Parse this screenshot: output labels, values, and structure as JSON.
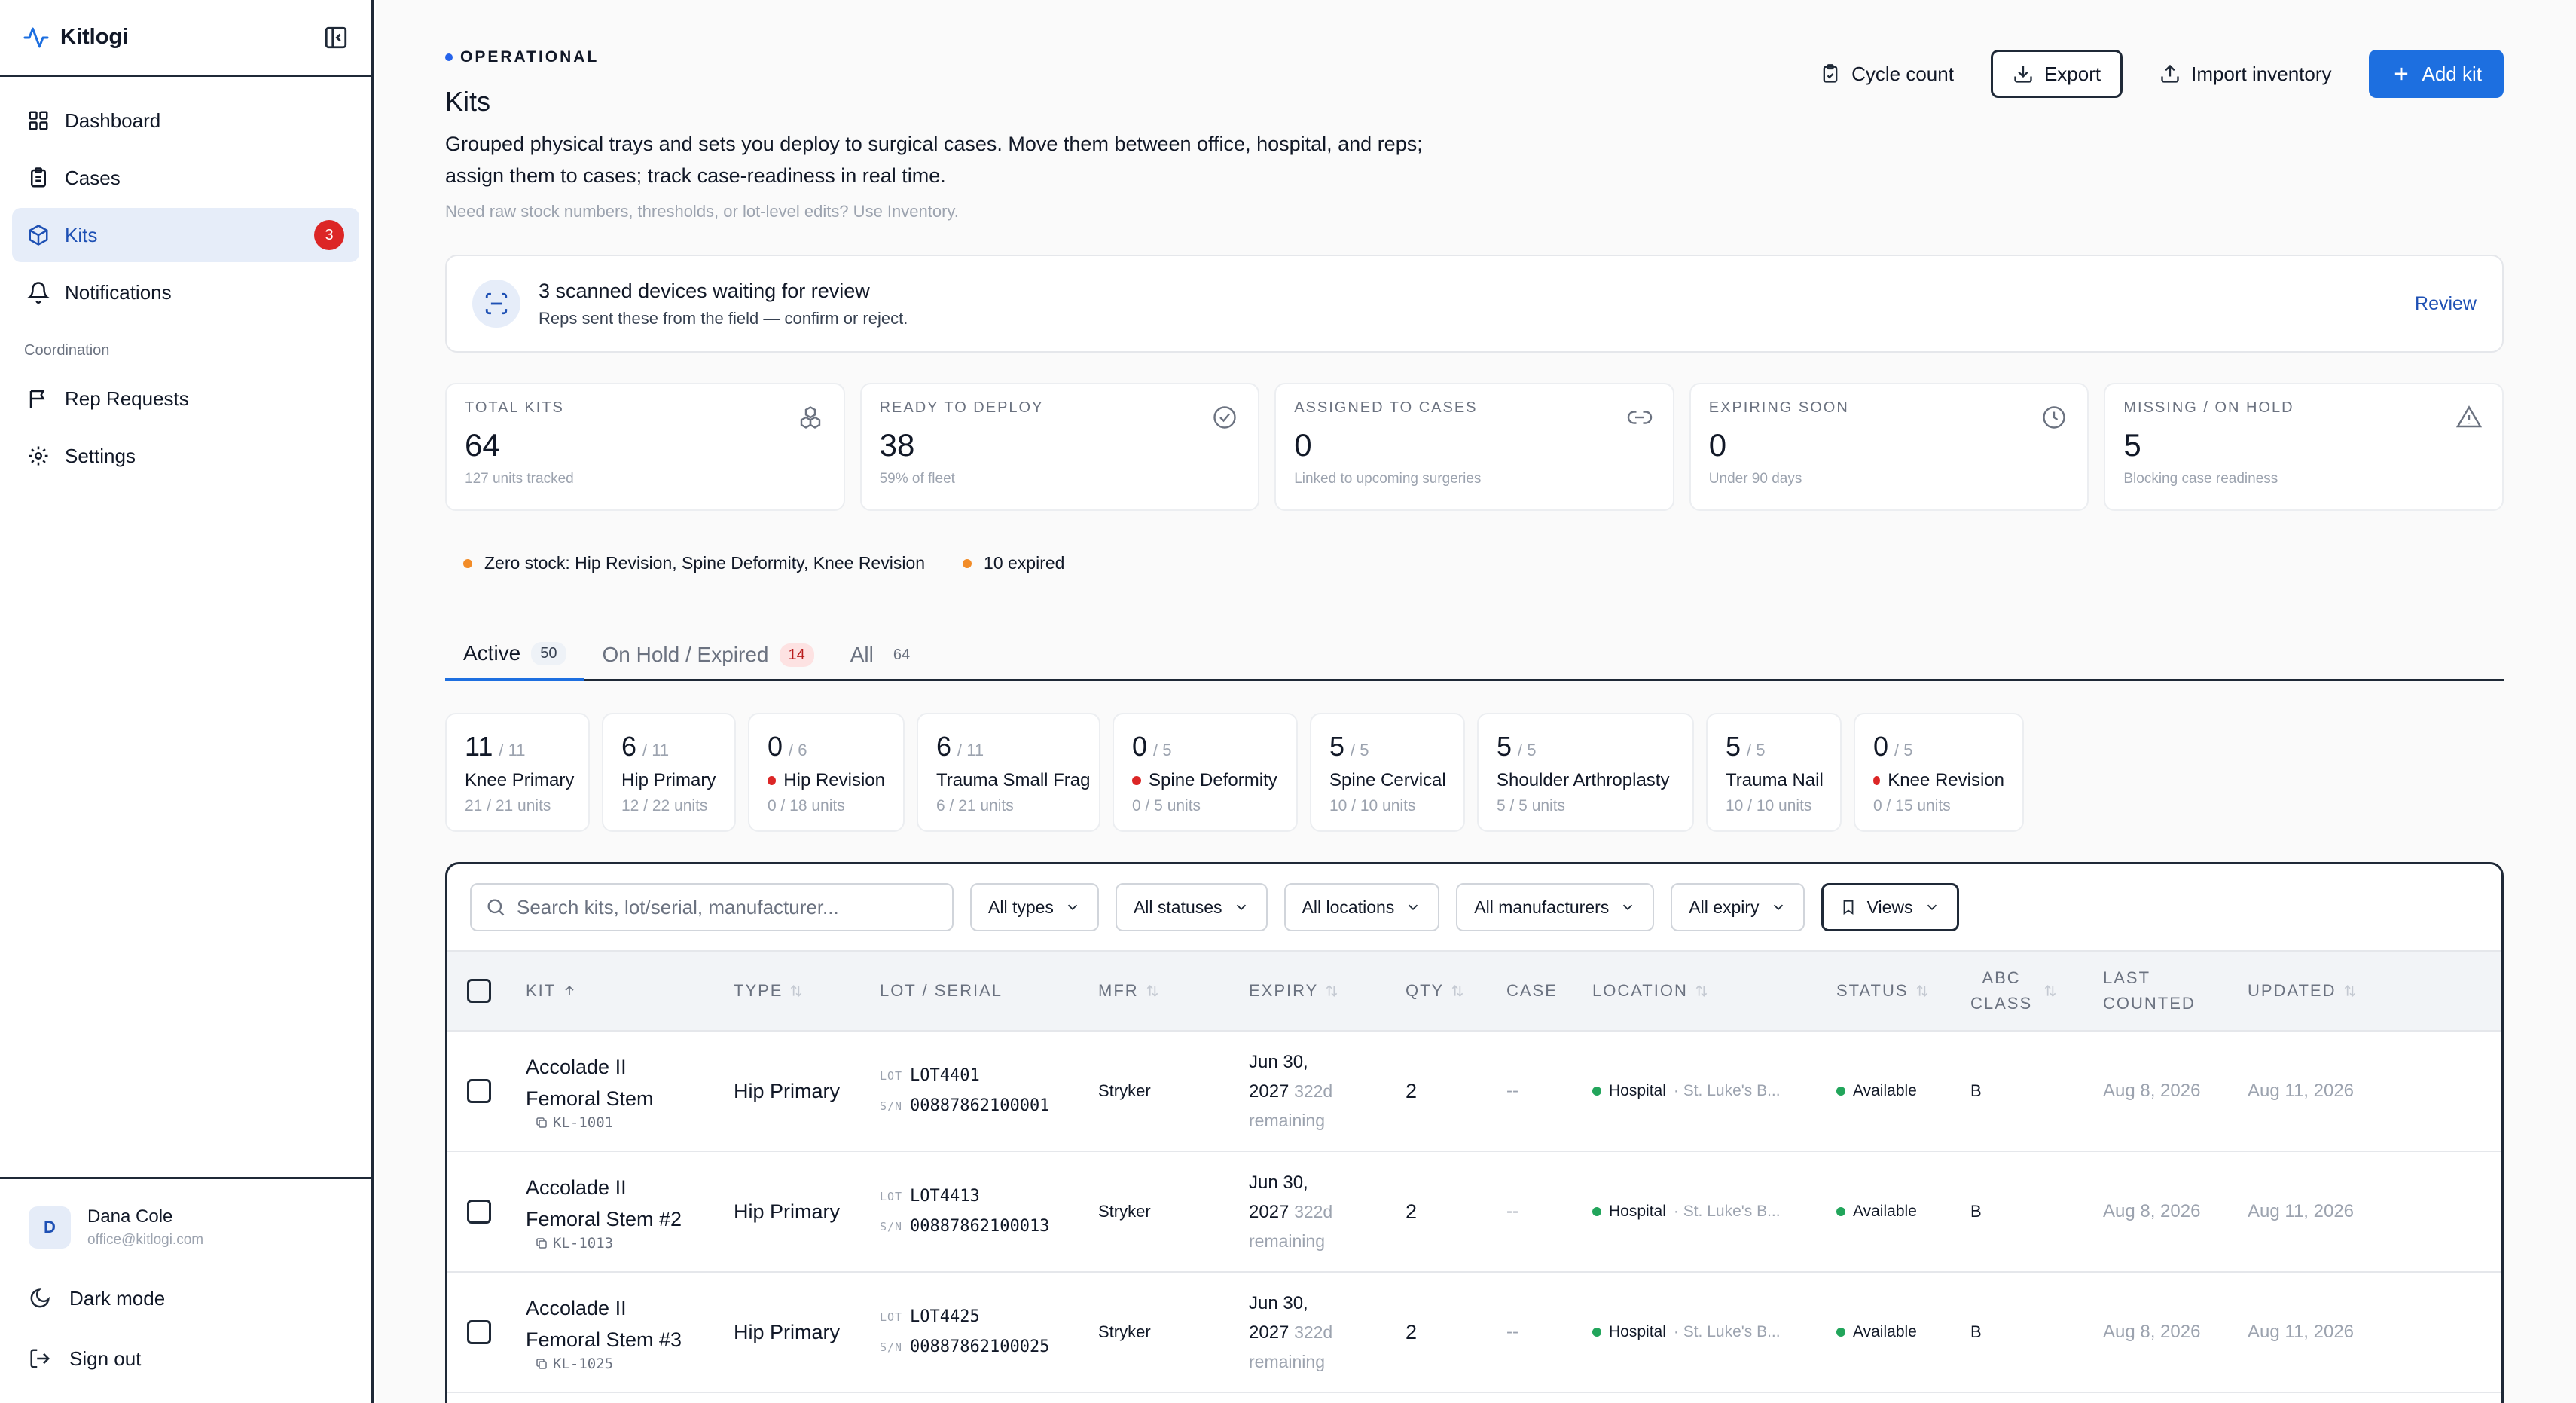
{
  "app": {
    "name": "Kitlogi"
  },
  "sidebar": {
    "items": [
      {
        "label": "Dashboard"
      },
      {
        "label": "Cases"
      },
      {
        "label": "Kits",
        "badge": "3"
      },
      {
        "label": "Notifications"
      }
    ],
    "section_label": "Coordination",
    "items2": [
      {
        "label": "Rep Requests"
      },
      {
        "label": "Settings"
      }
    ],
    "user": {
      "initial": "D",
      "name": "Dana Cole",
      "email": "office@kitlogi.com"
    },
    "dark_mode": "Dark mode",
    "sign_out": "Sign out"
  },
  "header": {
    "status": "OPERATIONAL",
    "title": "Kits",
    "description": "Grouped physical trays and sets you deploy to surgical cases. Move them between office, hospital, and reps; assign them to cases; track case-readiness in real time.",
    "note": "Need raw stock numbers, thresholds, or lot-level edits? Use Inventory."
  },
  "actions": {
    "cycle_count": "Cycle count",
    "export": "Export",
    "import": "Import inventory",
    "add": "Add kit"
  },
  "banner": {
    "title": "3 scanned devices waiting for review",
    "subtitle": "Reps sent these from the field — confirm or reject.",
    "link": "Review"
  },
  "stats": [
    {
      "label": "Total kits",
      "value": "64",
      "sub": "127 units tracked",
      "icon": "boxes-icon"
    },
    {
      "label": "Ready to deploy",
      "value": "38",
      "sub": "59% of fleet",
      "icon": "check-circle-icon"
    },
    {
      "label": "Assigned to cases",
      "value": "0",
      "sub": "Linked to upcoming surgeries",
      "icon": "link-icon"
    },
    {
      "label": "Expiring soon",
      "value": "0",
      "sub": "Under 90 days",
      "icon": "clock-icon"
    },
    {
      "label": "Missing / on hold",
      "value": "5",
      "sub": "Blocking case readiness",
      "icon": "warning-icon"
    }
  ],
  "alerts": {
    "zero_stock": "Zero stock: Hip Revision, Spine Deformity, Knee Revision",
    "expired": "10 expired"
  },
  "tabs": [
    {
      "label": "Active",
      "count": "50"
    },
    {
      "label": "On Hold / Expired",
      "count": "14"
    },
    {
      "label": "All",
      "count": "64"
    }
  ],
  "kit_types": [
    {
      "count": "11",
      "total": "/ 11",
      "name": "Knee Primary",
      "units": "21 / 21 units",
      "alert": false
    },
    {
      "count": "6",
      "total": "/ 11",
      "name": "Hip Primary",
      "units": "12 / 22 units",
      "alert": false
    },
    {
      "count": "0",
      "total": "/ 6",
      "name": "Hip Revision",
      "units": "0 / 18 units",
      "alert": true
    },
    {
      "count": "6",
      "total": "/ 11",
      "name": "Trauma Small Frag",
      "units": "6 / 21 units",
      "alert": false
    },
    {
      "count": "0",
      "total": "/ 5",
      "name": "Spine Deformity",
      "units": "0 / 5 units",
      "alert": true
    },
    {
      "count": "5",
      "total": "/ 5",
      "name": "Spine Cervical",
      "units": "10 / 10 units",
      "alert": false
    },
    {
      "count": "5",
      "total": "/ 5",
      "name": "Shoulder Arthroplasty",
      "units": "5 / 5 units",
      "alert": false
    },
    {
      "count": "5",
      "total": "/ 5",
      "name": "Trauma Nail",
      "units": "10 / 10 units",
      "alert": false
    },
    {
      "count": "0",
      "total": "/ 5",
      "name": "Knee Revision",
      "units": "0 / 15 units",
      "alert": true
    }
  ],
  "toolbar": {
    "search_placeholder": "Search kits, lot/serial, manufacturer...",
    "filters": [
      "All types",
      "All statuses",
      "All locations",
      "All manufacturers",
      "All expiry"
    ],
    "views": "Views"
  },
  "table": {
    "headers": {
      "kit": "KIT",
      "type": "TYPE",
      "lot": "LOT / SERIAL",
      "mfr": "MFR",
      "expiry": "EXPIRY",
      "qty": "QTY",
      "case": "CASE",
      "location": "LOCATION",
      "status": "STATUS",
      "abc_1": "ABC",
      "abc_2": "CLASS",
      "last_1": "LAST",
      "last_2": "COUNTED",
      "updated": "UPDATED"
    },
    "lot_tag": "LOT",
    "sn_tag": "S/N",
    "rows": [
      {
        "name_1": "Accolade II",
        "name_2": "Femoral Stem",
        "id": "KL-1001",
        "type": "Hip Primary",
        "lot": "LOT4401",
        "sn": "00887862100001",
        "mfr": "Stryker",
        "exp_1": "Jun 30,",
        "exp_2": "2027",
        "exp_rem": "322d",
        "exp_3": "remaining",
        "qty": "2",
        "case": "--",
        "loc": "Hospital",
        "loc_sub": "· St. Luke's B...",
        "status": "Available",
        "abc": "B",
        "last": "Aug 8, 2026",
        "updated": "Aug 11, 2026"
      },
      {
        "name_1": "Accolade II",
        "name_2": "Femoral Stem #2",
        "id": "KL-1013",
        "type": "Hip Primary",
        "lot": "LOT4413",
        "sn": "00887862100013",
        "mfr": "Stryker",
        "exp_1": "Jun 30,",
        "exp_2": "2027",
        "exp_rem": "322d",
        "exp_3": "remaining",
        "qty": "2",
        "case": "--",
        "loc": "Hospital",
        "loc_sub": "· St. Luke's B...",
        "status": "Available",
        "abc": "B",
        "last": "Aug 8, 2026",
        "updated": "Aug 11, 2026"
      },
      {
        "name_1": "Accolade II",
        "name_2": "Femoral Stem #3",
        "id": "KL-1025",
        "type": "Hip Primary",
        "lot": "LOT4425",
        "sn": "00887862100025",
        "mfr": "Stryker",
        "exp_1": "Jun 30,",
        "exp_2": "2027",
        "exp_rem": "322d",
        "exp_3": "remaining",
        "qty": "2",
        "case": "--",
        "loc": "Hospital",
        "loc_sub": "· St. Luke's B...",
        "status": "Available",
        "abc": "B",
        "last": "Aug 8, 2026",
        "updated": "Aug 11, 2026"
      }
    ]
  }
}
